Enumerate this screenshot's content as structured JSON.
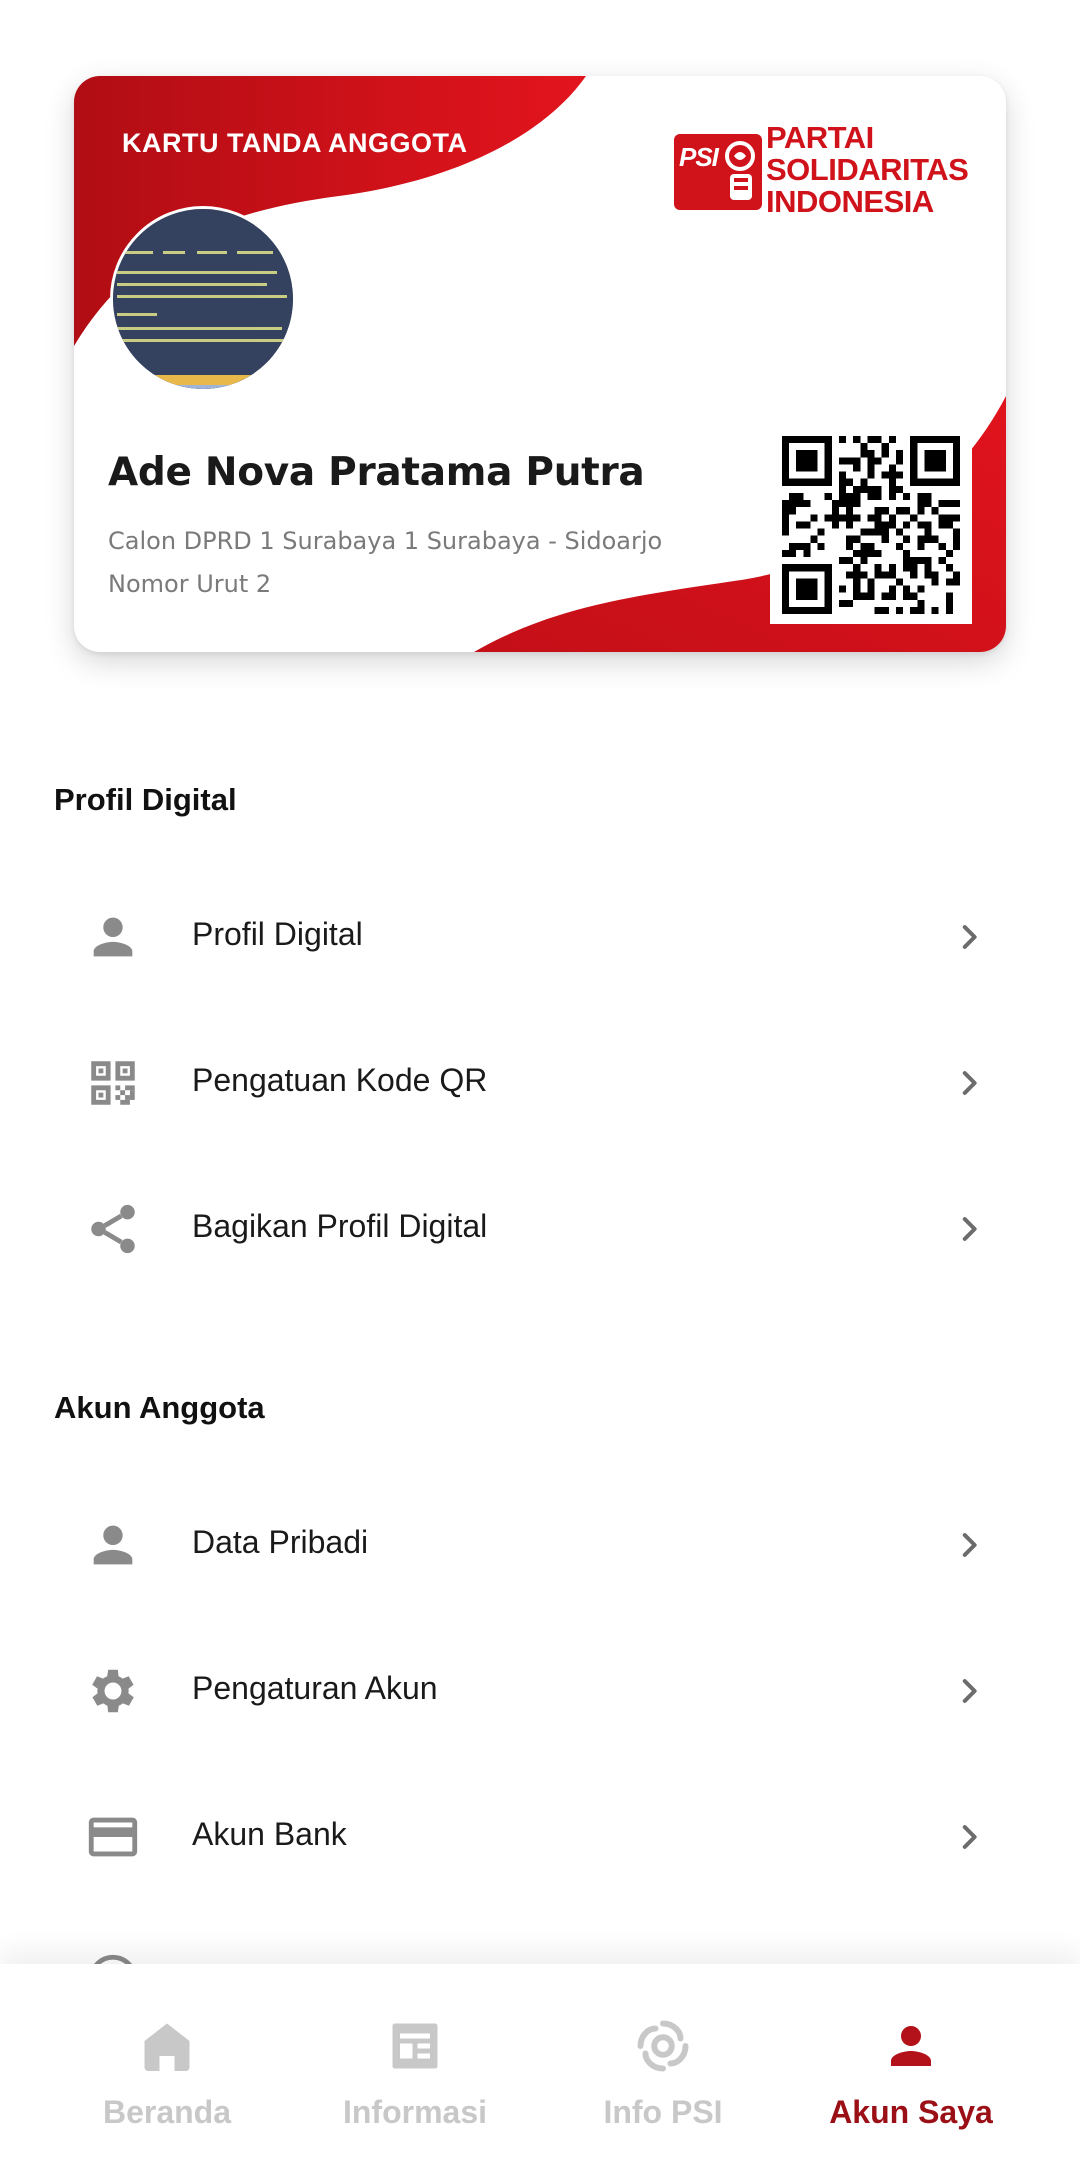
{
  "card": {
    "title": "KARTU TANDA ANGGOTA",
    "logo_badge": "PSI",
    "logo_lines": [
      "PARTAI",
      "SOLIDARITAS",
      "INDONESIA"
    ],
    "member_name": "Ade Nova Pratama Putra",
    "candidacy": "Calon DPRD 1 Surabaya 1 Surabaya - Sidoarjo",
    "number": "Nomor Urut 2",
    "brand_color": "#d0121b"
  },
  "sections": {
    "digital": {
      "title": "Profil Digital",
      "items": [
        {
          "label": "Profil Digital",
          "icon": "person-icon"
        },
        {
          "label": "Pengatuan Kode QR",
          "icon": "qr-code-icon"
        },
        {
          "label": "Bagikan Profil Digital",
          "icon": "share-icon"
        }
      ]
    },
    "account": {
      "title": "Akun Anggota",
      "items": [
        {
          "label": "Data Pribadi",
          "icon": "person-icon"
        },
        {
          "label": "Pengaturan Akun",
          "icon": "gear-icon"
        },
        {
          "label": "Akun Bank",
          "icon": "credit-card-icon"
        }
      ]
    }
  },
  "nav": {
    "items": [
      {
        "label": "Beranda",
        "icon": "home-icon",
        "active": false
      },
      {
        "label": "Informasi",
        "icon": "newspaper-icon",
        "active": false
      },
      {
        "label": "Info PSI",
        "icon": "psi-swirl-icon",
        "active": false
      },
      {
        "label": "Akun Saya",
        "icon": "person-icon",
        "active": true
      }
    ],
    "active_color": "#9b1016",
    "inactive_color": "#c8c8c8"
  }
}
